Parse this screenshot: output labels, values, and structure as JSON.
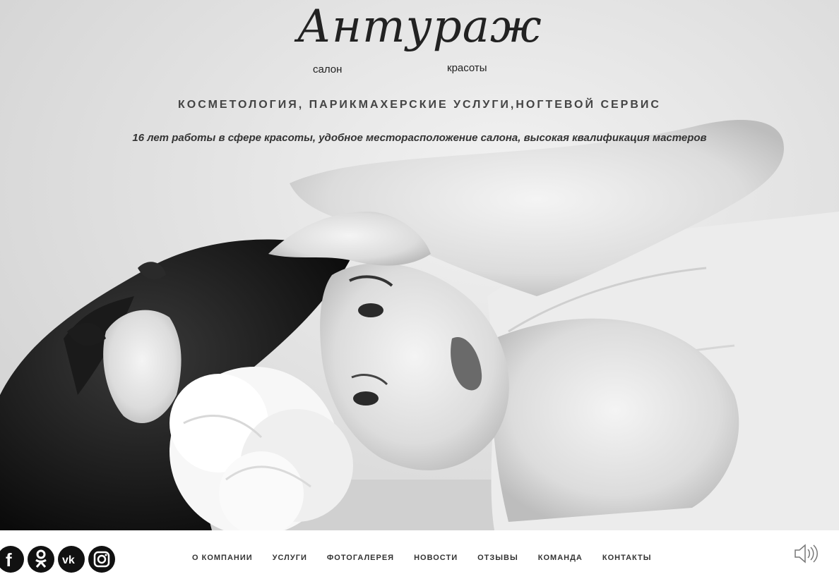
{
  "logo": {
    "script": "Антураж",
    "left_word": "салон",
    "right_word": "красоты"
  },
  "tagline": "КОСМЕТОЛОГИЯ, ПАРИКМАХЕРСКИЕ УСЛУГИ,НОГТЕВОЙ СЕРВИС",
  "subtagline": "16 лет работы в сфере красоты, удобное месторасположение салона, высокая квалификация мастеров",
  "social": [
    {
      "icon": "facebook-icon"
    },
    {
      "icon": "odnoklassniki-icon"
    },
    {
      "icon": "vk-icon"
    },
    {
      "icon": "instagram-icon"
    }
  ],
  "nav": [
    "О КОМПАНИИ",
    "УСЛУГИ",
    "ФОТОГАЛЕРЕЯ",
    "НОВОСТИ",
    "ОТЗЫВЫ",
    "КОМАНДА",
    "КОНТАКТЫ"
  ],
  "sound_icon": "speaker-icon",
  "colors": {
    "text_dark": "#333333",
    "icon_bg": "#111111",
    "footer_bg": "#ffffff"
  }
}
